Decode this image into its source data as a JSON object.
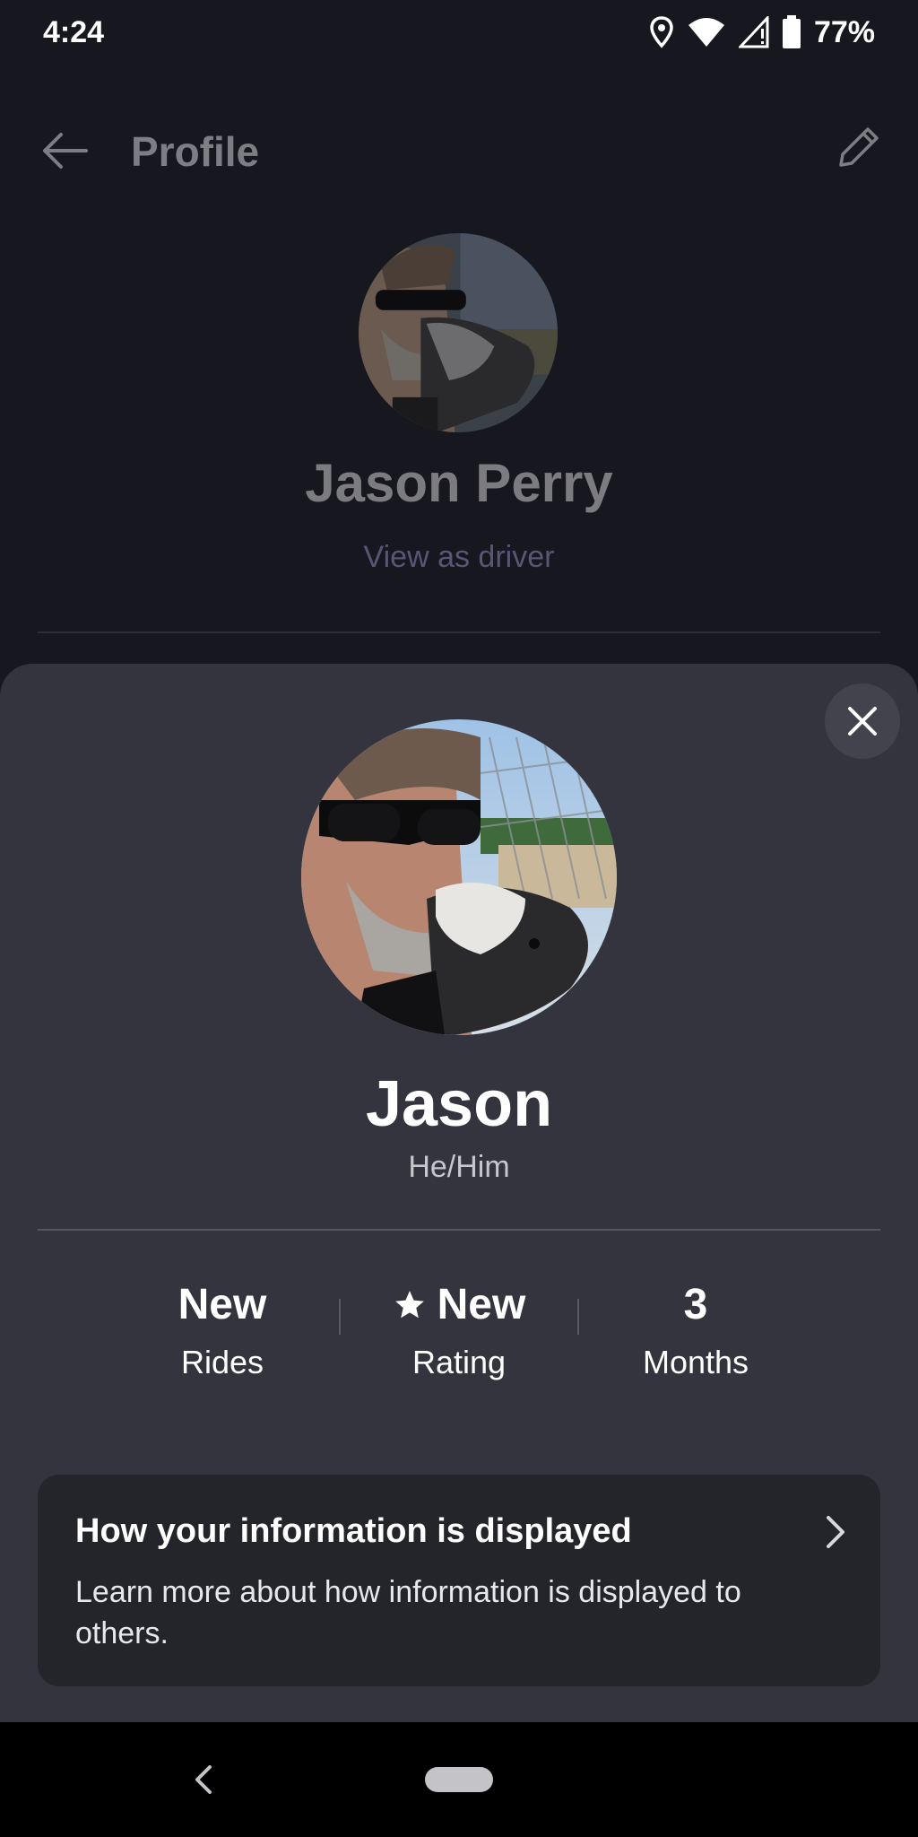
{
  "status_bar": {
    "time": "4:24",
    "battery": "77%",
    "icons": [
      "location-icon",
      "wifi-icon",
      "signal-icon",
      "battery-icon"
    ]
  },
  "header": {
    "title": "Profile",
    "back_icon": "arrow-left-icon",
    "edit_icon": "pencil-icon"
  },
  "background_profile": {
    "full_name": "Jason Perry",
    "view_as_driver": "View as driver"
  },
  "sheet": {
    "name": "Jason",
    "pronouns": "He/Him",
    "stats": [
      {
        "value": "New",
        "label": "Rides"
      },
      {
        "value": "New",
        "label": "Rating",
        "icon": "star-icon"
      },
      {
        "value": "3",
        "label": "Months"
      }
    ],
    "info_card": {
      "title": "How your information is displayed",
      "body": "Learn more about how information is displayed to others."
    }
  },
  "colors": {
    "background": "#17171f",
    "sheet": "#34343f",
    "card": "#24242b",
    "muted_link": "#5a5575"
  }
}
